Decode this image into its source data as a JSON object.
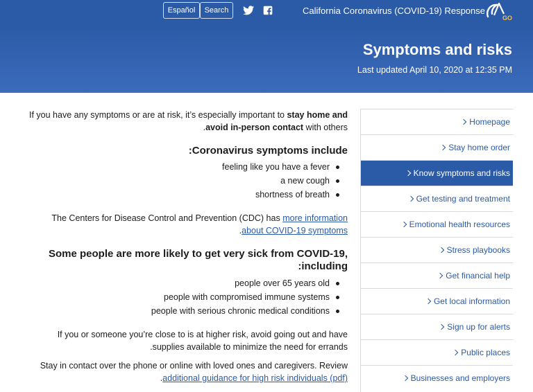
{
  "topbar": {
    "espanol_label": "Español",
    "search_label": "Search",
    "site_title": "California Coronavirus (COVID-19) Response",
    "logo_text": "GOV",
    "twitter_icon": "twitter-icon",
    "facebook_icon": "facebook-icon"
  },
  "header": {
    "title": "Symptoms and risks",
    "updated": "Last updated April 10, 2020 at 12:35 PM"
  },
  "content": {
    "intro_a": "If you have any symptoms or are at risk, it’s especially important to ",
    "intro_b": "stay home and avoid in-person contact",
    "intro_c": " with others.",
    "symptoms_heading": "Coronavirus symptoms include:",
    "symptoms": [
      "feeling like you have a fever",
      "a new cough",
      "shortness of breath"
    ],
    "cdc_a": "The Centers for Disease Control and Prevention (CDC) has ",
    "cdc_link": "more information about COVID-19 symptoms",
    "cdc_c": ".",
    "risk_heading": "Some people are more likely to get very sick from COVID-19, including:",
    "risk_groups": [
      "people over 65 years old",
      "people with compromised immune systems",
      "people with serious chronic medical conditions"
    ],
    "higher_risk": "If you or someone you’re close to is at higher risk, avoid going out and have supplies available to minimize the need for errands.",
    "contact_a": "Stay in contact over the phone or online with loved ones and caregivers. Review ",
    "contact_link": "additional guidance for high risk individuals (pdf)",
    "contact_c": "."
  },
  "sidenav": {
    "items": [
      {
        "label": "Homepage",
        "active": false
      },
      {
        "label": "Stay home order",
        "active": false
      },
      {
        "label": "Know symptoms and risks",
        "active": true
      },
      {
        "label": "Get testing and treatment",
        "active": false
      },
      {
        "label": "Emotional health resources",
        "active": false
      },
      {
        "label": "Stress playbooks",
        "active": false
      },
      {
        "label": "Get financial help",
        "active": false
      },
      {
        "label": "Get local information",
        "active": false
      },
      {
        "label": "Sign up for alerts",
        "active": false
      },
      {
        "label": "Public places",
        "active": false
      },
      {
        "label": "Businesses and employers",
        "active": false
      }
    ]
  },
  "colors": {
    "brand_blue": "#2b5aa7",
    "link_blue": "#2b5aa7",
    "text": "#1c1c1c"
  }
}
